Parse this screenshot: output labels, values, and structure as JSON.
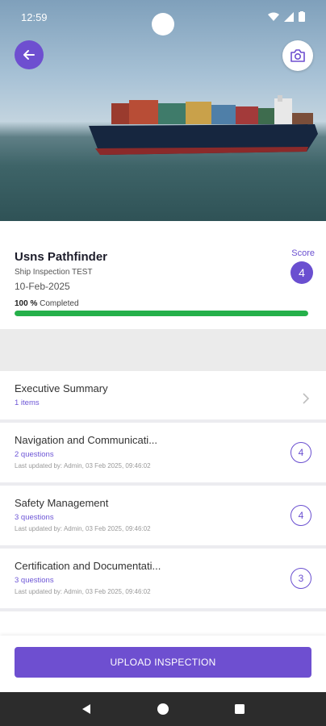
{
  "status_bar": {
    "time": "12:59"
  },
  "header": {
    "back_icon": "arrow-left-icon",
    "camera_icon": "camera-icon"
  },
  "inspection": {
    "ship_name": "Usns Pathfinder",
    "type": "Ship Inspection TEST",
    "date": "10-Feb-2025",
    "score_label": "Score",
    "score": "4",
    "completed_value": "100 %",
    "completed_label": "Completed",
    "progress_fraction": 1.0
  },
  "sections": [
    {
      "title": "Executive Summary",
      "sub": "1 items",
      "meta": "",
      "badge": ""
    },
    {
      "title": "Navigation and Communicati...",
      "sub": "2 questions",
      "meta": "Last updated by: Admin, 03 Feb 2025, 09:46:02",
      "badge": "4"
    },
    {
      "title": "Safety Management",
      "sub": "3 questions",
      "meta": "Last updated by: Admin, 03 Feb 2025, 09:46:02",
      "badge": "4"
    },
    {
      "title": "Certification and Documentati...",
      "sub": "3 questions",
      "meta": "Last updated by: Admin, 03 Feb 2025, 09:46:02",
      "badge": "3"
    }
  ],
  "actions": {
    "upload_label": "UPLOAD INSPECTION"
  },
  "colors": {
    "accent": "#6e4fd0",
    "progress": "#25b04a"
  }
}
